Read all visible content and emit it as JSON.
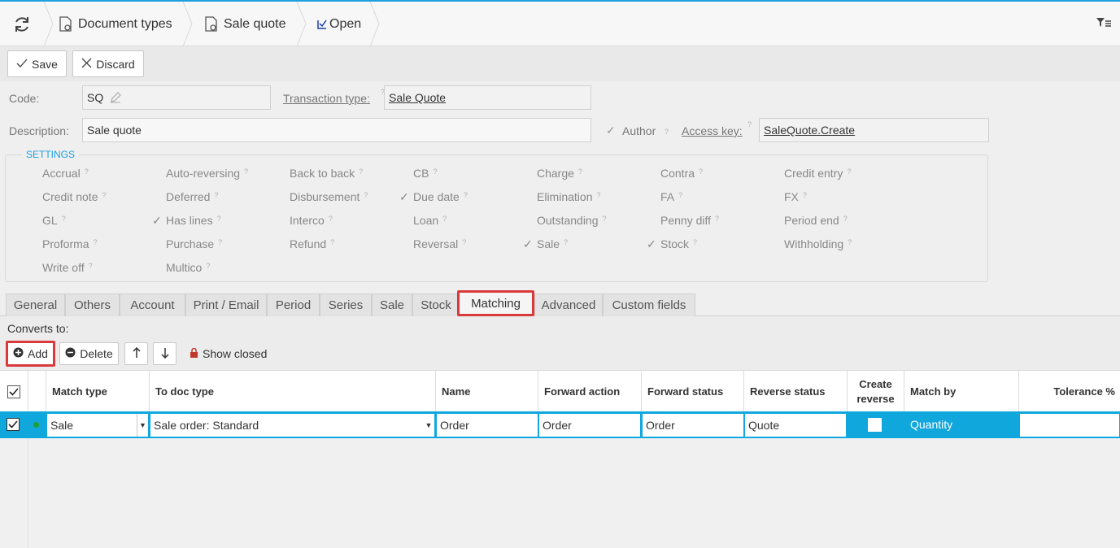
{
  "breadcrumb": {
    "items": [
      {
        "label": "Document types"
      },
      {
        "label": "Sale quote"
      },
      {
        "label": "Open"
      }
    ]
  },
  "toolbar": {
    "save_label": "Save",
    "discard_label": "Discard"
  },
  "form": {
    "code_label": "Code:",
    "code_value": "SQ",
    "transaction_type_label": "Transaction type:",
    "transaction_type_value": "Sale Quote",
    "description_label": "Description:",
    "description_value": "Sale quote",
    "author_label": "Author",
    "access_key_label": "Access key:",
    "access_key_value": "SaleQuote.Create"
  },
  "settings": {
    "title": "SETTINGS",
    "items": [
      {
        "label": "Accrual",
        "checked": false
      },
      {
        "label": "Auto-reversing",
        "checked": false
      },
      {
        "label": "Back to back",
        "checked": false
      },
      {
        "label": "CB",
        "checked": false
      },
      {
        "label": "Charge",
        "checked": false
      },
      {
        "label": "Contra",
        "checked": false
      },
      {
        "label": "Credit entry",
        "checked": false
      },
      {
        "label": "Credit note",
        "checked": false
      },
      {
        "label": "Deferred",
        "checked": false
      },
      {
        "label": "Disbursement",
        "checked": false
      },
      {
        "label": "Due date",
        "checked": true
      },
      {
        "label": "Elimination",
        "checked": false
      },
      {
        "label": "FA",
        "checked": false
      },
      {
        "label": "FX",
        "checked": false
      },
      {
        "label": "GL",
        "checked": false
      },
      {
        "label": "Has lines",
        "checked": true
      },
      {
        "label": "Interco",
        "checked": false
      },
      {
        "label": "Loan",
        "checked": false
      },
      {
        "label": "Outstanding",
        "checked": false
      },
      {
        "label": "Penny diff",
        "checked": false
      },
      {
        "label": "Period end",
        "checked": false
      },
      {
        "label": "Proforma",
        "checked": false
      },
      {
        "label": "Purchase",
        "checked": false
      },
      {
        "label": "Refund",
        "checked": false
      },
      {
        "label": "Reversal",
        "checked": false
      },
      {
        "label": "Sale",
        "checked": true
      },
      {
        "label": "Stock",
        "checked": true
      },
      {
        "label": "Withholding",
        "checked": false
      },
      {
        "label": "Write off",
        "checked": false
      },
      {
        "label": "Multico",
        "checked": false
      }
    ]
  },
  "tabs": [
    {
      "label": "General"
    },
    {
      "label": "Others"
    },
    {
      "label": "Account"
    },
    {
      "label": "Print / Email"
    },
    {
      "label": "Period"
    },
    {
      "label": "Series"
    },
    {
      "label": "Sale"
    },
    {
      "label": "Stock"
    },
    {
      "label": "Matching"
    },
    {
      "label": "Advanced"
    },
    {
      "label": "Custom fields"
    }
  ],
  "matching": {
    "converts_to_label": "Converts to:",
    "add_label": "Add",
    "delete_label": "Delete",
    "show_closed_label": "Show closed",
    "columns": [
      "Match type",
      "To doc type",
      "Name",
      "Forward action",
      "Forward status",
      "Reverse status",
      "Create",
      "reverse",
      "Match by",
      "Tolerance %"
    ],
    "row": {
      "match_type": "Sale",
      "to_doc_type": "Sale order: Standard",
      "name": "Order",
      "forward_action": "Order",
      "forward_status": "Order",
      "reverse_status": "Quote",
      "match_by": "Quantity",
      "tolerance": ""
    }
  },
  "colors": {
    "accent": "#1ba1e2",
    "highlight": "#d9393b",
    "row_selected": "#10a7dd"
  }
}
